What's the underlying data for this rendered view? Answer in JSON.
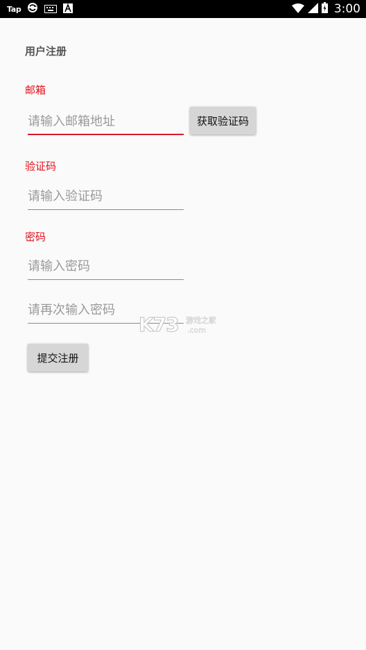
{
  "status_bar": {
    "app_label": "Tap",
    "time": "3:00",
    "icons": [
      "sync-icon",
      "keyboard-icon",
      "text-a-icon",
      "wifi-icon",
      "signal-icon",
      "battery-icon"
    ]
  },
  "page": {
    "title": "用户注册"
  },
  "email_section": {
    "label": "邮箱",
    "placeholder": "请输入邮箱地址",
    "value": "",
    "get_code_button": "获取验证码"
  },
  "code_section": {
    "label": "验证码",
    "placeholder": "请输入验证码",
    "value": ""
  },
  "password_section": {
    "label": "密码",
    "password_placeholder": "请输入密码",
    "confirm_placeholder": "请再次输入密码",
    "password_value": "",
    "confirm_value": ""
  },
  "submit_button": "提交注册",
  "watermark": {
    "brand": "K73",
    "site_name": "游戏之家",
    "domain": ".com"
  },
  "colors": {
    "accent_red": "#e0111b",
    "active_underline": "#d81b26",
    "button_bg": "#d6d6d6",
    "page_bg": "#fafafa"
  }
}
